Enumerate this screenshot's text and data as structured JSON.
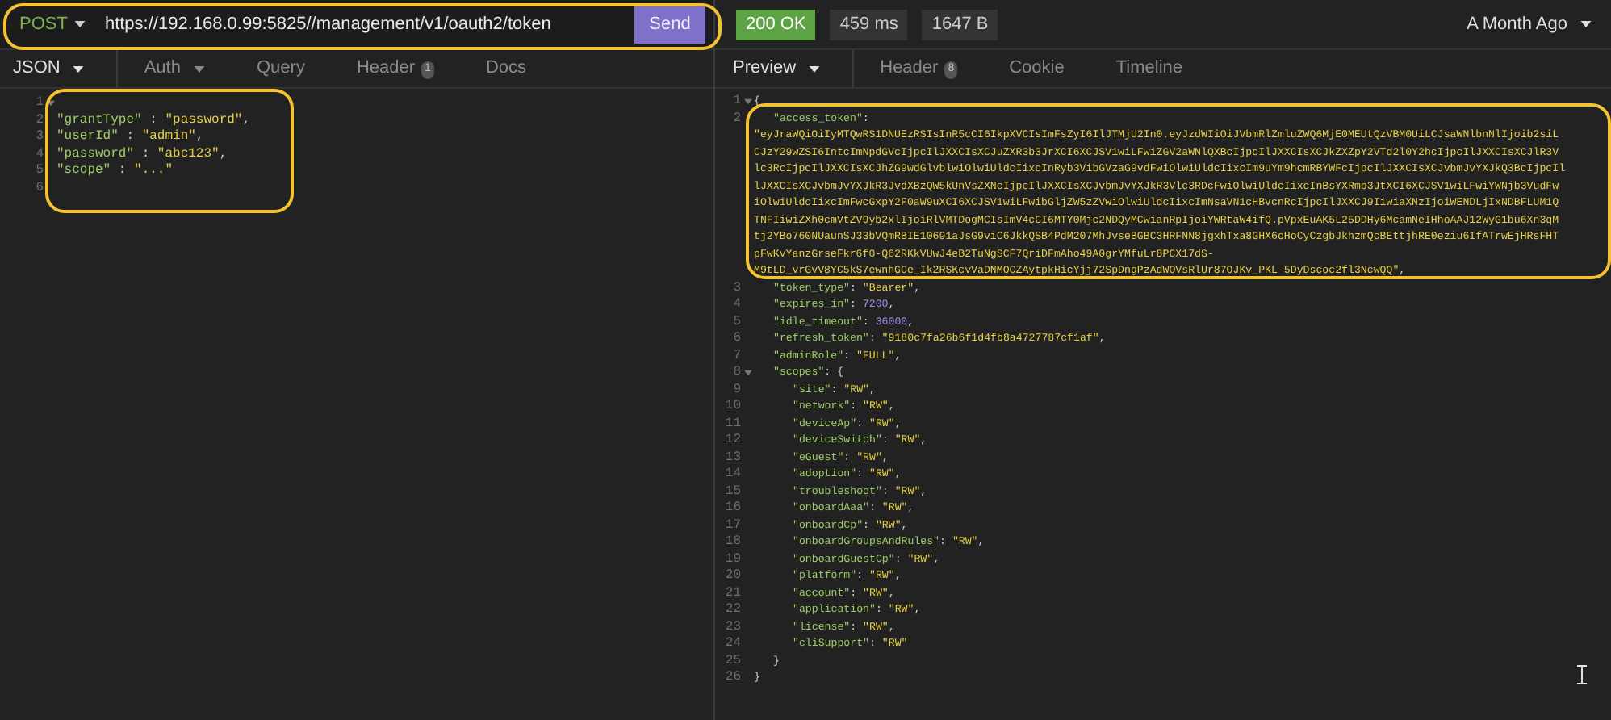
{
  "request": {
    "method": "POST",
    "url": "https://192.168.0.99:5825//management/v1/oauth2/token",
    "send": "Send"
  },
  "request_tabs": [
    {
      "label": "JSON",
      "selected": true,
      "dropdown": true
    },
    {
      "label": "Auth",
      "selected": false,
      "dropdown": true
    },
    {
      "label": "Query",
      "selected": false,
      "dropdown": false
    },
    {
      "label": "Header",
      "badge": "1",
      "selected": false,
      "dropdown": false
    },
    {
      "label": "Docs",
      "selected": false,
      "dropdown": false
    }
  ],
  "request_body": [
    {
      "number": "1",
      "children": [
        {
          "number": "2",
          "tokens": [
            {
              "kind": "key",
              "text": "\"grantType\""
            },
            {
              "kind": "punct",
              "text": " : "
            },
            {
              "kind": "string",
              "text": "\"password\""
            },
            {
              "kind": "punct",
              "text": ","
            }
          ]
        },
        {
          "number": "3",
          "tokens": [
            {
              "kind": "key",
              "text": "\"userId\""
            },
            {
              "kind": "punct",
              "text": " : "
            },
            {
              "kind": "string",
              "text": "\"admin\""
            },
            {
              "kind": "punct",
              "text": ","
            }
          ]
        },
        {
          "number": "4",
          "tokens": [
            {
              "kind": "key",
              "text": "\"password\""
            },
            {
              "kind": "punct",
              "text": " : "
            },
            {
              "kind": "string",
              "text": "\"abc123\""
            },
            {
              "kind": "punct",
              "text": ","
            }
          ]
        },
        {
          "number": "5",
          "tokens": [
            {
              "kind": "key",
              "text": "\"scope\""
            },
            {
              "kind": "punct",
              "text": " : "
            },
            {
              "kind": "string",
              "text": "\"...\""
            }
          ]
        }
      ],
      "close": {
        "number": "6"
      }
    }
  ],
  "response": {
    "status": "200 OK",
    "time": "459 ms",
    "size": "1647 B",
    "history": "A Month Ago"
  },
  "response_tabs": [
    {
      "label": "Preview",
      "selected": true,
      "dropdown": true
    },
    {
      "label": "Header",
      "badge": "8",
      "selected": false,
      "dropdown": false
    },
    {
      "label": "Cookie",
      "selected": false,
      "dropdown": false
    },
    {
      "label": "Timeline",
      "selected": false,
      "dropdown": false
    }
  ],
  "response_body": [
    {
      "number": "1",
      "tokens": [
        {
          "kind": "punct",
          "text": "{"
        }
      ],
      "children": [
        {
          "number": "2",
          "tokens": [
            {
              "kind": "key",
              "text": "\"access_token\""
            },
            {
              "kind": "punct",
              "text": ":"
            }
          ],
          "wrapped": [
            [
              {
                "kind": "string",
                "text": "\"eyJraWQiOiIyMTQwRS1DNUEzRSIsInR5cCI6IkpXVCIsImFsZyI6IlJTMjU2In0.eyJzdWIiOiJVbmRlZmluZWQ6MjE0MEUtQzVBM0UiLCJsaWNlbnNlIjoib2siL"
              }
            ],
            [
              {
                "kind": "string",
                "text": "CJzY29wZSI6IntcImNpdGVcIjpcIlJXXCIsXCJuZXR3b3JrXCI6XCJSV1wiLFwiZGV2aWNlQXBcIjpcIlJXXCIsXCJkZXZpY2VTd2l0Y2hcIjpcIlJXXCIsXCJlR3V"
              }
            ],
            [
              {
                "kind": "string",
                "text": "lc3RcIjpcIlJXXCIsXCJhZG9wdGlvblwiOlwiUldcIixcInRyb3VibGVzaG9vdFwiOlwiUldcIixcIm9uYm9hcmRBYWFcIjpcIlJXXCIsXCJvbmJvYXJkQ3BcIjpcIl"
              }
            ],
            [
              {
                "kind": "string",
                "text": "lJXXCIsXCJvbmJvYXJkR3JvdXBzQW5kUnVsZXNcIjpcIlJXXCIsXCJvbmJvYXJkR3Vlc3RDcFwiOlwiUldcIixcInBsYXRmb3JtXCI6XCJSV1wiLFwiYWNjb3VudFw"
              }
            ],
            [
              {
                "kind": "string",
                "text": "iOlwiUldcIixcImFwcGxpY2F0aW9uXCI6XCJSV1wiLFwibGljZW5zZVwiOlwiUldcIixcImNsaVN1cHBvcnRcIjpcIlJXXCJ9IiwiaXNzIjoiWENDLjIxNDBFLUM1Q"
              }
            ],
            [
              {
                "kind": "string",
                "text": "TNFIiwiZXh0cmVtZV9yb2xlIjoiRlVMTDogMCIsImV4cCI6MTY0Mjc2NDQyMCwianRpIjoiYWRtaW4ifQ.pVpxEuAK5L25DDHy6McamNeIHhoAAJ12WyG1bu6Xn3qM"
              }
            ],
            [
              {
                "kind": "string",
                "text": "tj2YBo760NUaunSJ33bVQmRBIE10691aJsG9viC6JkkQSB4PdM207MhJvseBGBC3HRFNN8jgxhTxa8GHX6oHoCyCzgbJkhzmQcBEttjhRE0eziu6IfATrwEjHRsFHT"
              }
            ],
            [
              {
                "kind": "string",
                "text": "pFwKvYanzGrseFkr6f0-Q62RKkVUwJ4eB2TuNgSCF7QriDFmAho49A0grYMfuLr8PCX17dS-"
              }
            ],
            [
              {
                "kind": "string",
                "text": "M9tLD_vrGvV8YC5kS7ewnhGCe_Ik2RSKcvVaDNMOCZAytpkHicYjj72SpDngPzAdWOVsRlUr87OJKv_PKL-5DyDscoc2fl3NcwQQ\""
              },
              {
                "kind": "punct",
                "text": ","
              }
            ]
          ]
        },
        {
          "number": "3",
          "tokens": [
            {
              "kind": "key",
              "text": "\"token_type\""
            },
            {
              "kind": "punct",
              "text": ": "
            },
            {
              "kind": "string",
              "text": "\"Bearer\""
            },
            {
              "kind": "punct",
              "text": ","
            }
          ]
        },
        {
          "number": "4",
          "tokens": [
            {
              "kind": "key",
              "text": "\"expires_in\""
            },
            {
              "kind": "punct",
              "text": ": "
            },
            {
              "kind": "number",
              "text": "7200"
            },
            {
              "kind": "punct",
              "text": ","
            }
          ]
        },
        {
          "number": "5",
          "tokens": [
            {
              "kind": "key",
              "text": "\"idle_timeout\""
            },
            {
              "kind": "punct",
              "text": ": "
            },
            {
              "kind": "number",
              "text": "36000"
            },
            {
              "kind": "punct",
              "text": ","
            }
          ]
        },
        {
          "number": "6",
          "tokens": [
            {
              "kind": "key",
              "text": "\"refresh_token\""
            },
            {
              "kind": "punct",
              "text": ": "
            },
            {
              "kind": "string",
              "text": "\"9180c7fa26b6f1d4fb8a4727787cf1af\""
            },
            {
              "kind": "punct",
              "text": ","
            }
          ]
        },
        {
          "number": "7",
          "tokens": [
            {
              "kind": "key",
              "text": "\"adminRole\""
            },
            {
              "kind": "punct",
              "text": ": "
            },
            {
              "kind": "string",
              "text": "\"FULL\""
            },
            {
              "kind": "punct",
              "text": ","
            }
          ]
        },
        {
          "number": "8",
          "tokens": [
            {
              "kind": "key",
              "text": "\"scopes\""
            },
            {
              "kind": "punct",
              "text": ": {"
            }
          ],
          "children": [
            {
              "number": "9",
              "tokens": [
                {
                  "kind": "key",
                  "text": "\"site\""
                },
                {
                  "kind": "punct",
                  "text": ": "
                },
                {
                  "kind": "string",
                  "text": "\"RW\""
                },
                {
                  "kind": "punct",
                  "text": ","
                }
              ]
            },
            {
              "number": "10",
              "tokens": [
                {
                  "kind": "key",
                  "text": "\"network\""
                },
                {
                  "kind": "punct",
                  "text": ": "
                },
                {
                  "kind": "string",
                  "text": "\"RW\""
                },
                {
                  "kind": "punct",
                  "text": ","
                }
              ]
            },
            {
              "number": "11",
              "tokens": [
                {
                  "kind": "key",
                  "text": "\"deviceAp\""
                },
                {
                  "kind": "punct",
                  "text": ": "
                },
                {
                  "kind": "string",
                  "text": "\"RW\""
                },
                {
                  "kind": "punct",
                  "text": ","
                }
              ]
            },
            {
              "number": "12",
              "tokens": [
                {
                  "kind": "key",
                  "text": "\"deviceSwitch\""
                },
                {
                  "kind": "punct",
                  "text": ": "
                },
                {
                  "kind": "string",
                  "text": "\"RW\""
                },
                {
                  "kind": "punct",
                  "text": ","
                }
              ]
            },
            {
              "number": "13",
              "tokens": [
                {
                  "kind": "key",
                  "text": "\"eGuest\""
                },
                {
                  "kind": "punct",
                  "text": ": "
                },
                {
                  "kind": "string",
                  "text": "\"RW\""
                },
                {
                  "kind": "punct",
                  "text": ","
                }
              ]
            },
            {
              "number": "14",
              "tokens": [
                {
                  "kind": "key",
                  "text": "\"adoption\""
                },
                {
                  "kind": "punct",
                  "text": ": "
                },
                {
                  "kind": "string",
                  "text": "\"RW\""
                },
                {
                  "kind": "punct",
                  "text": ","
                }
              ]
            },
            {
              "number": "15",
              "tokens": [
                {
                  "kind": "key",
                  "text": "\"troubleshoot\""
                },
                {
                  "kind": "punct",
                  "text": ": "
                },
                {
                  "kind": "string",
                  "text": "\"RW\""
                },
                {
                  "kind": "punct",
                  "text": ","
                }
              ]
            },
            {
              "number": "16",
              "tokens": [
                {
                  "kind": "key",
                  "text": "\"onboardAaa\""
                },
                {
                  "kind": "punct",
                  "text": ": "
                },
                {
                  "kind": "string",
                  "text": "\"RW\""
                },
                {
                  "kind": "punct",
                  "text": ","
                }
              ]
            },
            {
              "number": "17",
              "tokens": [
                {
                  "kind": "key",
                  "text": "\"onboardCp\""
                },
                {
                  "kind": "punct",
                  "text": ": "
                },
                {
                  "kind": "string",
                  "text": "\"RW\""
                },
                {
                  "kind": "punct",
                  "text": ","
                }
              ]
            },
            {
              "number": "18",
              "tokens": [
                {
                  "kind": "key",
                  "text": "\"onboardGroupsAndRules\""
                },
                {
                  "kind": "punct",
                  "text": ": "
                },
                {
                  "kind": "string",
                  "text": "\"RW\""
                },
                {
                  "kind": "punct",
                  "text": ","
                }
              ]
            },
            {
              "number": "19",
              "tokens": [
                {
                  "kind": "key",
                  "text": "\"onboardGuestCp\""
                },
                {
                  "kind": "punct",
                  "text": ": "
                },
                {
                  "kind": "string",
                  "text": "\"RW\""
                },
                {
                  "kind": "punct",
                  "text": ","
                }
              ]
            },
            {
              "number": "20",
              "tokens": [
                {
                  "kind": "key",
                  "text": "\"platform\""
                },
                {
                  "kind": "punct",
                  "text": ": "
                },
                {
                  "kind": "string",
                  "text": "\"RW\""
                },
                {
                  "kind": "punct",
                  "text": ","
                }
              ]
            },
            {
              "number": "21",
              "tokens": [
                {
                  "kind": "key",
                  "text": "\"account\""
                },
                {
                  "kind": "punct",
                  "text": ": "
                },
                {
                  "kind": "string",
                  "text": "\"RW\""
                },
                {
                  "kind": "punct",
                  "text": ","
                }
              ]
            },
            {
              "number": "22",
              "tokens": [
                {
                  "kind": "key",
                  "text": "\"application\""
                },
                {
                  "kind": "punct",
                  "text": ": "
                },
                {
                  "kind": "string",
                  "text": "\"RW\""
                },
                {
                  "kind": "punct",
                  "text": ","
                }
              ]
            },
            {
              "number": "23",
              "tokens": [
                {
                  "kind": "key",
                  "text": "\"license\""
                },
                {
                  "kind": "punct",
                  "text": ": "
                },
                {
                  "kind": "string",
                  "text": "\"RW\""
                },
                {
                  "kind": "punct",
                  "text": ","
                }
              ]
            },
            {
              "number": "24",
              "tokens": [
                {
                  "kind": "key",
                  "text": "\"cliSupport\""
                },
                {
                  "kind": "punct",
                  "text": ": "
                },
                {
                  "kind": "string",
                  "text": "\"RW\""
                }
              ]
            }
          ],
          "close": {
            "number": "25",
            "tokens": [
              {
                "kind": "punct",
                "text": "}"
              }
            ]
          }
        }
      ],
      "close": {
        "number": "26",
        "tokens": [
          {
            "kind": "punct",
            "text": "}"
          }
        ]
      }
    }
  ]
}
